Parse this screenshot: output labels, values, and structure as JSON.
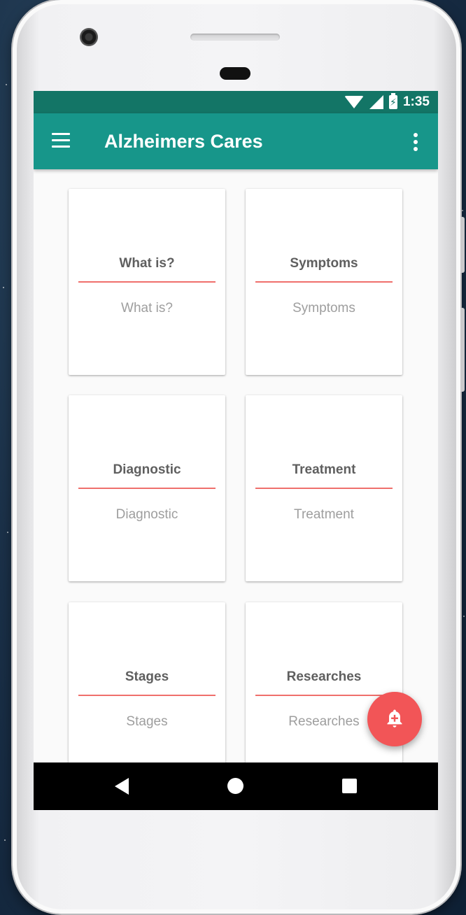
{
  "status_bar": {
    "time": "1:35",
    "icons": [
      "wifi-icon",
      "cell-signal-icon",
      "battery-charging-icon"
    ]
  },
  "toolbar": {
    "menu_icon": "hamburger-menu-icon",
    "title": "Alzheimers Cares",
    "overflow_icon": "more-vert-icon"
  },
  "cards": [
    {
      "title": "What is?",
      "subtitle": "What is?"
    },
    {
      "title": "Symptoms",
      "subtitle": "Symptoms"
    },
    {
      "title": "Diagnostic",
      "subtitle": "Diagnostic"
    },
    {
      "title": "Treatment",
      "subtitle": "Treatment"
    },
    {
      "title": "Stages",
      "subtitle": "Stages"
    },
    {
      "title": "Researches",
      "subtitle": "Researches"
    }
  ],
  "fab": {
    "icon": "add-alert-icon"
  },
  "nav_bar": {
    "icons": [
      "back-icon",
      "home-icon",
      "recents-icon"
    ]
  },
  "colors": {
    "status_bar": "#137566",
    "primary": "#17968a",
    "accent": "#f25557",
    "divider": "#ef6f6c",
    "card_title": "#5f5f5f",
    "card_subtitle": "#9e9e9e"
  }
}
